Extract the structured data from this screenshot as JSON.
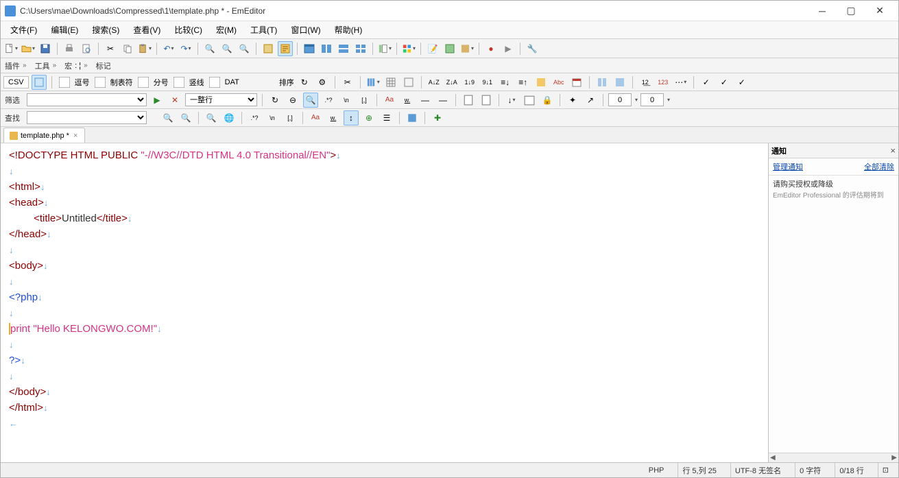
{
  "window": {
    "title": "C:\\Users\\mae\\Downloads\\Compressed\\1\\template.php * - EmEditor"
  },
  "menus": [
    "文件(F)",
    "编辑(E)",
    "搜索(S)",
    "查看(V)",
    "比较(C)",
    "宏(M)",
    "工具(T)",
    "窗口(W)",
    "帮助(H)"
  ],
  "minibar": {
    "plugins": "插件",
    "tools": "工具",
    "macro": "宏",
    "marks": "标记"
  },
  "csvbar": {
    "csv": "CSV",
    "comma": "逗号",
    "tab": "制表符",
    "semi": "分号",
    "pipe": "竖线",
    "dat": "DAT",
    "sort": "排序"
  },
  "filter": {
    "label": "筛选",
    "line_mode": "一整行",
    "zero1": "0",
    "zero2": "0"
  },
  "find": {
    "label": "查找"
  },
  "tab": {
    "name": "template.php *"
  },
  "code": {
    "l1a": "<!DOCTYPE HTML PUBLIC ",
    "l1b": "\"-//W3C//DTD HTML 4.0 Transitional//EN\"",
    "l1c": ">",
    "l3": "<html>",
    "l4": "<head>",
    "l5a": "<title>",
    "l5b": "Untitled",
    "l5c": "</title>",
    "l6": "</head>",
    "l8": "<body>",
    "l10": "<?php",
    "l12a": "print ",
    "l12b": "\"Hello KELONGWO.COM!\"",
    "l14": "?>",
    "l16": "</body>",
    "l17": "</html>",
    "eol": "↓",
    "eof": "←"
  },
  "panel": {
    "title": "通知",
    "link_manage": "管理通知",
    "link_clear": "全部清除",
    "msg_title": "请购买授权或降级",
    "msg_sub": "EmEditor Professional 的评估期将到"
  },
  "status": {
    "lang": "PHP",
    "pos": "行 5,列 25",
    "enc": "UTF-8 无签名",
    "chars": "0 字符",
    "lines": "0/18 行"
  }
}
